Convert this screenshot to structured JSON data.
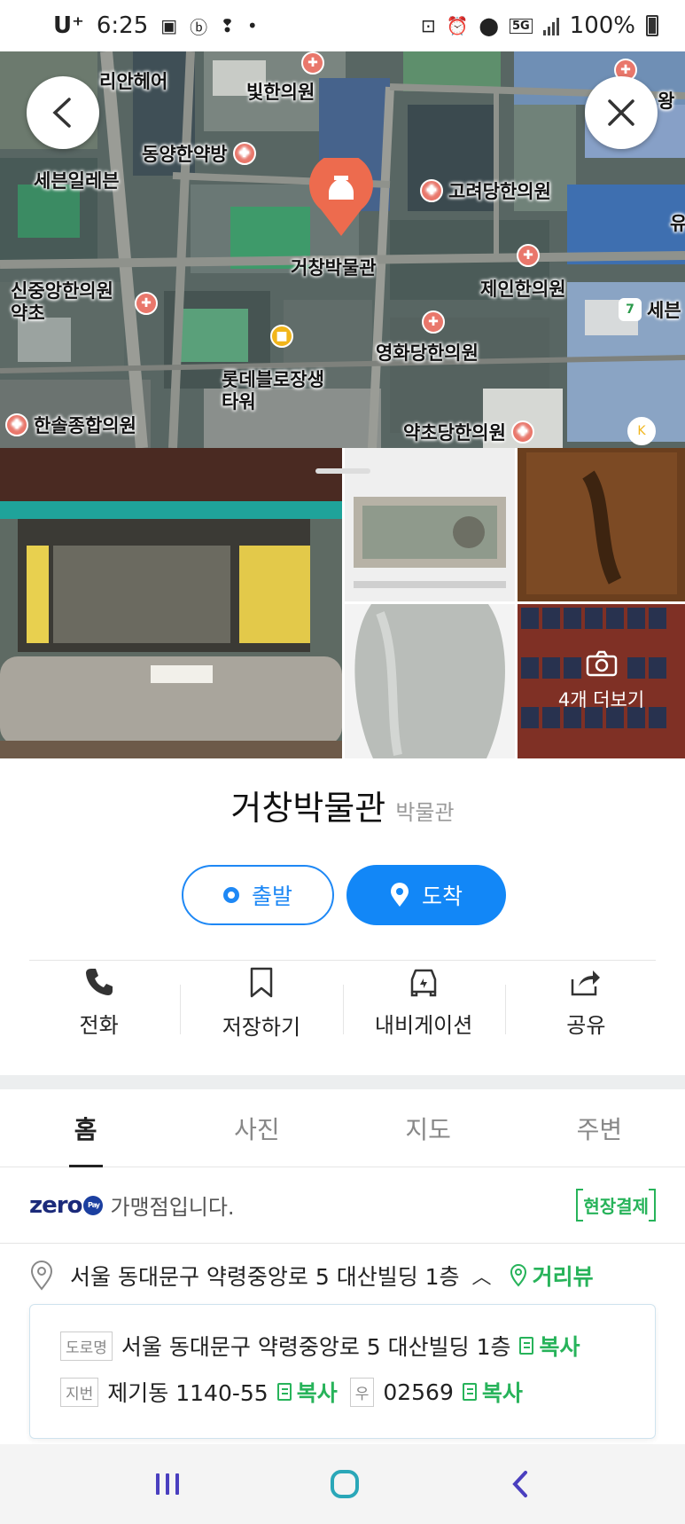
{
  "status_bar": {
    "carrier": "U⁺",
    "time": "6:25",
    "network": "5G",
    "battery": "100%"
  },
  "map": {
    "selected_place_label": "거창박물관",
    "pois": [
      {
        "id": "lian",
        "label": "리안헤어"
      },
      {
        "id": "bit",
        "label": "빛한의원"
      },
      {
        "id": "seven1",
        "label": "세븐일레븐"
      },
      {
        "id": "dongyang",
        "label": "동양한약방"
      },
      {
        "id": "goryeo",
        "label": "고려당한의원"
      },
      {
        "id": "sinjungang",
        "label": "신중앙한의원\n약초"
      },
      {
        "id": "jein",
        "label": "제인한의원"
      },
      {
        "id": "seven2",
        "label": "세븐"
      },
      {
        "id": "yeonghwa",
        "label": "영화당한의원"
      },
      {
        "id": "lotte",
        "label": "롯데블로장생\n타워"
      },
      {
        "id": "hansol",
        "label": "한솔종합의원"
      },
      {
        "id": "yakcho",
        "label": "약초당한의원"
      },
      {
        "id": "wang",
        "label": "왕"
      },
      {
        "id": "yu",
        "label": "유"
      }
    ]
  },
  "photos": {
    "more_label": "4개 더보기"
  },
  "place": {
    "name": "거창박물관",
    "category": "박물관"
  },
  "route": {
    "start_label": "출발",
    "arrive_label": "도착"
  },
  "actions": [
    {
      "label": "전화",
      "icon": "phone-icon"
    },
    {
      "label": "저장하기",
      "icon": "bookmark-icon"
    },
    {
      "label": "내비게이션",
      "icon": "car-icon"
    },
    {
      "label": "공유",
      "icon": "share-icon"
    }
  ],
  "tabs": [
    {
      "label": "홈",
      "active": true
    },
    {
      "label": "사진",
      "active": false
    },
    {
      "label": "지도",
      "active": false
    },
    {
      "label": "주변",
      "active": false
    }
  ],
  "zero_pay": {
    "logo": "zero",
    "logo_badge": "Pay",
    "text": "가맹점입니다.",
    "onsite_label": "현장결제"
  },
  "address": {
    "summary": "서울 동대문구 약령중앙로 5 대산빌딩 1층",
    "street_view_label": "거리뷰",
    "road_tag": "도로명",
    "road": "서울 동대문구 약령중앙로 5 대산빌딩 1층",
    "lot_tag": "지번",
    "lot": "제기동 1140-55",
    "zip_tag": "우",
    "zip": "02569",
    "copy_label": "복사"
  },
  "colors": {
    "accent_blue": "#1287f7",
    "green": "#27b35a",
    "poi_red": "#e9776b"
  }
}
